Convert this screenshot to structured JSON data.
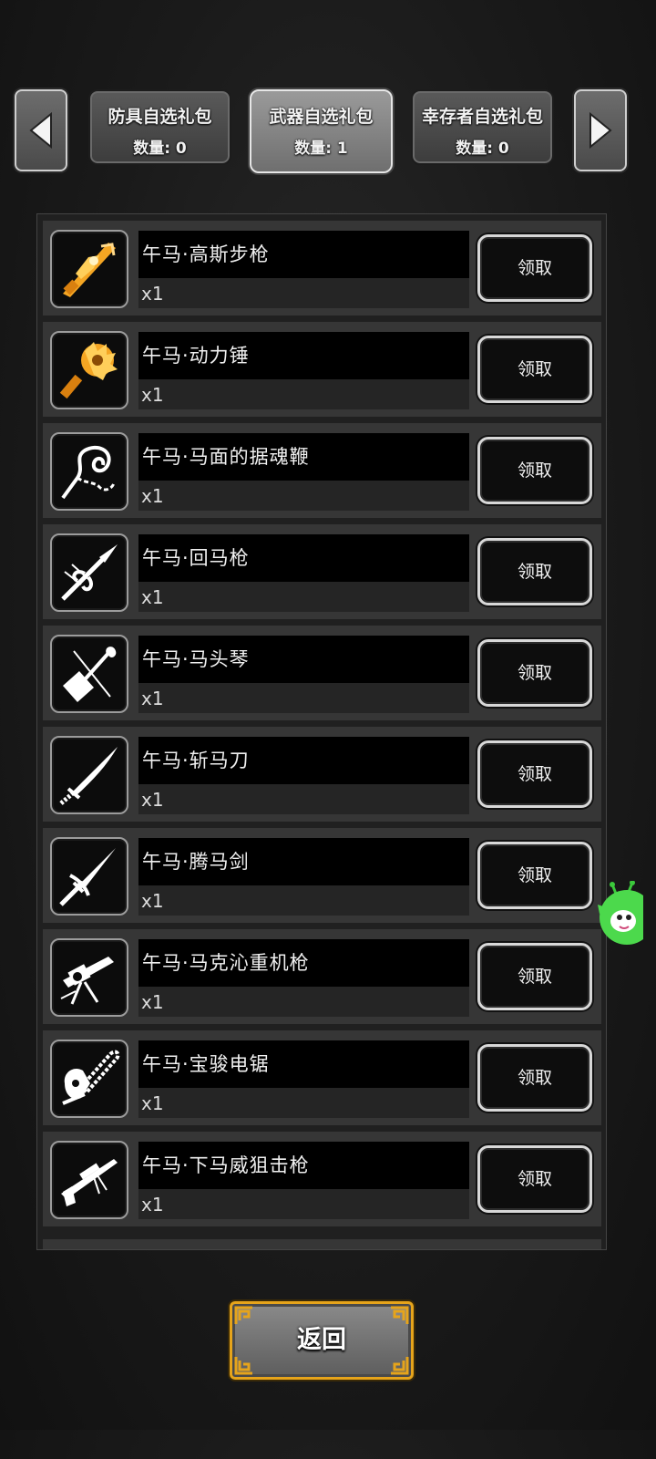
{
  "tabs": [
    {
      "title": "防具自选礼包",
      "count": "数量: 0",
      "active": false
    },
    {
      "title": "武器自选礼包",
      "count": "数量: 1",
      "active": true
    },
    {
      "title": "幸存者自选礼包",
      "count": "数量: 0",
      "active": false
    }
  ],
  "items": [
    {
      "name": "午马·高斯步枪",
      "qty": "x1",
      "button": "领取",
      "icon": "gauss-rifle-icon"
    },
    {
      "name": "午马·动力锤",
      "qty": "x1",
      "button": "领取",
      "icon": "power-hammer-icon"
    },
    {
      "name": "午马·马面的据魂鞭",
      "qty": "x1",
      "button": "领取",
      "icon": "soul-whip-icon"
    },
    {
      "name": "午马·回马枪",
      "qty": "x1",
      "button": "领取",
      "icon": "spear-icon"
    },
    {
      "name": "午马·马头琴",
      "qty": "x1",
      "button": "领取",
      "icon": "horsehead-fiddle-icon"
    },
    {
      "name": "午马·斩马刀",
      "qty": "x1",
      "button": "领取",
      "icon": "saber-icon"
    },
    {
      "name": "午马·腾马剑",
      "qty": "x1",
      "button": "领取",
      "icon": "sword-icon"
    },
    {
      "name": "午马·马克沁重机枪",
      "qty": "x1",
      "button": "领取",
      "icon": "heavy-machine-gun-icon"
    },
    {
      "name": "午马·宝骏电锯",
      "qty": "x1",
      "button": "领取",
      "icon": "chainsaw-icon"
    },
    {
      "name": "午马·下马威狙击枪",
      "qty": "x1",
      "button": "领取",
      "icon": "sniper-rifle-icon"
    }
  ],
  "back_label": "返回",
  "colors": {
    "gold_icon": "#f5a623",
    "gold_border": "#e6a41b"
  }
}
